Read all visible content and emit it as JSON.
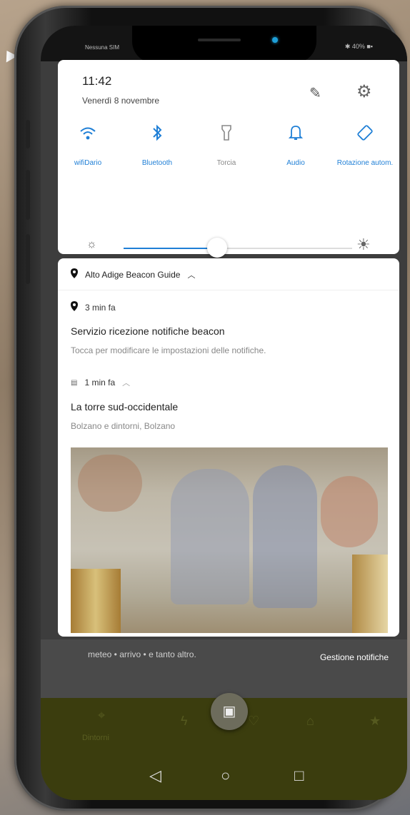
{
  "status_bar": {
    "carrier": "Nessuna SIM",
    "right": "✱ 40% ■▪"
  },
  "quick_settings": {
    "time": "11:42",
    "date": "Venerdì 8 novembre",
    "tiles": [
      {
        "label": "wifiDario",
        "icon": "wifi-icon",
        "state": "on"
      },
      {
        "label": "Bluetooth",
        "icon": "bluetooth-icon",
        "state": "on"
      },
      {
        "label": "Torcia",
        "icon": "flashlight-icon",
        "state": "off"
      },
      {
        "label": "Audio",
        "icon": "bell-icon",
        "state": "on"
      },
      {
        "label": "Rotazione autom.",
        "icon": "rotation-icon",
        "state": "on"
      }
    ],
    "brightness_level": 0.41
  },
  "notification": {
    "app_name": "Alto Adige Beacon Guide",
    "service": {
      "time": "3 min fa",
      "title": "Servizio ricezione notifiche beacon",
      "text": "Tocca per modificare le impostazioni delle notifiche."
    },
    "beacon": {
      "time": "1 min fa",
      "title": "La torre sud-occidentale",
      "text": "Bolzano e dintorni, Bolzano"
    }
  },
  "behind": {
    "text": "meteo • arrivo • e tanto altro.",
    "manage": "Gestione notifiche",
    "nav_label": "Dintorni"
  },
  "colors": {
    "accent": "#1f7fd6",
    "app_bar": "#3b3d0e"
  }
}
